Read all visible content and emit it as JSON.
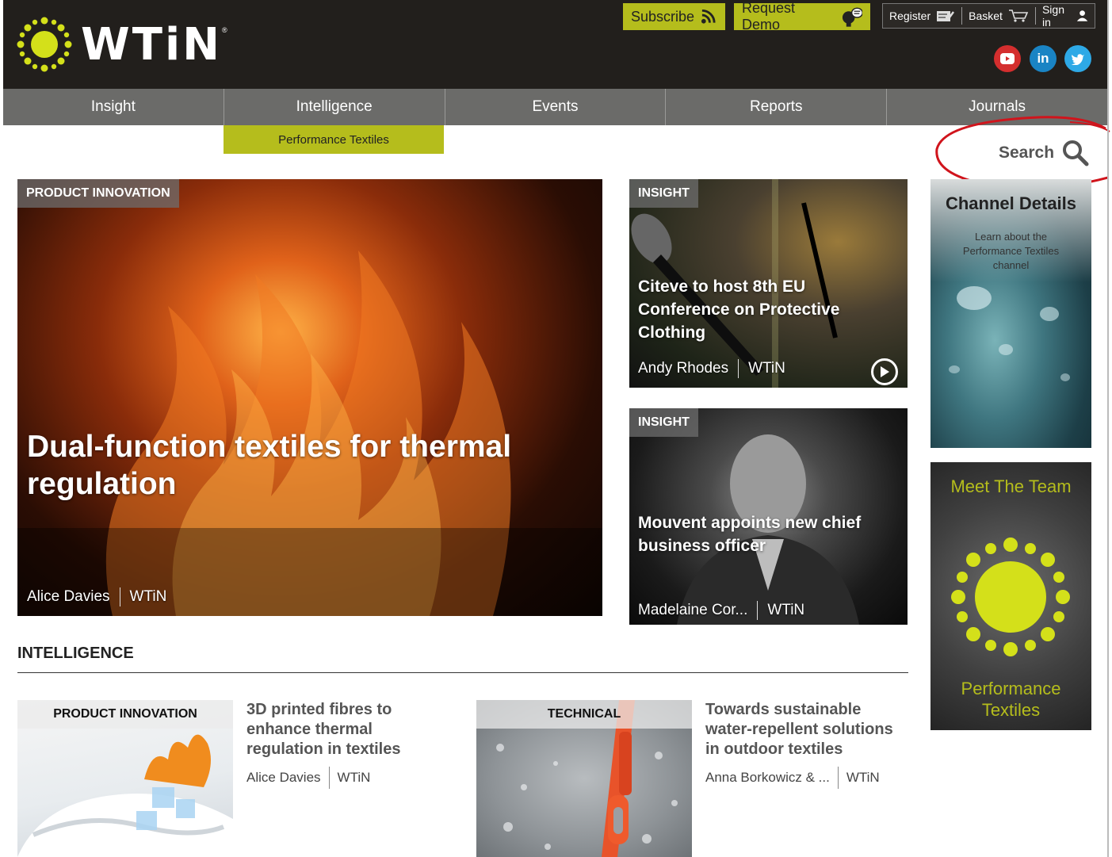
{
  "header": {
    "logo_text": "WTiN",
    "logo_reg": "®",
    "subscribe": "Subscribe",
    "request_demo": "Request Demo",
    "register": "Register",
    "basket": "Basket",
    "sign_in": "Sign in",
    "social_icons": [
      "youtube-icon",
      "linkedin-icon",
      "twitter-icon"
    ]
  },
  "nav": {
    "items": [
      "Insight",
      "Intelligence",
      "Events",
      "Reports",
      "Journals"
    ],
    "subnav": "Performance Textiles"
  },
  "search": {
    "label": "Search"
  },
  "hero": {
    "tag": "PRODUCT INNOVATION",
    "title": "Dual-function textiles for thermal regulation",
    "author": "Alice Davies",
    "source": "WTiN"
  },
  "card2": {
    "tag": "INSIGHT",
    "title": "Citeve to host 8th EU Conference on Protective Clothing",
    "author": "Andy Rhodes",
    "source": "WTiN"
  },
  "card3": {
    "tag": "INSIGHT",
    "title": "Mouvent appoints new chief business officer",
    "author": "Madelaine Cor...",
    "source": "WTiN"
  },
  "channel": {
    "title": "Channel Details",
    "subtitle": "Learn about the Performance Textiles channel"
  },
  "team": {
    "title": "Meet The Team",
    "footer": "Performance Textiles"
  },
  "section": {
    "title": "INTELLIGENCE"
  },
  "articles": [
    {
      "tag": "PRODUCT INNOVATION",
      "title": "3D printed fibres to enhance thermal regulation in textiles",
      "author": "Alice Davies",
      "source": "WTiN"
    },
    {
      "tag": "TECHNICAL",
      "title": "Towards sustainable water-repellent solutions in outdoor textiles",
      "author": "Anna Borkowicz & ...",
      "source": "WTiN"
    }
  ],
  "colors": {
    "accent": "#b5bd1c",
    "header_bg": "#221f1c",
    "nav_bg": "#6b6b69",
    "annotation_red": "#d0141c"
  }
}
